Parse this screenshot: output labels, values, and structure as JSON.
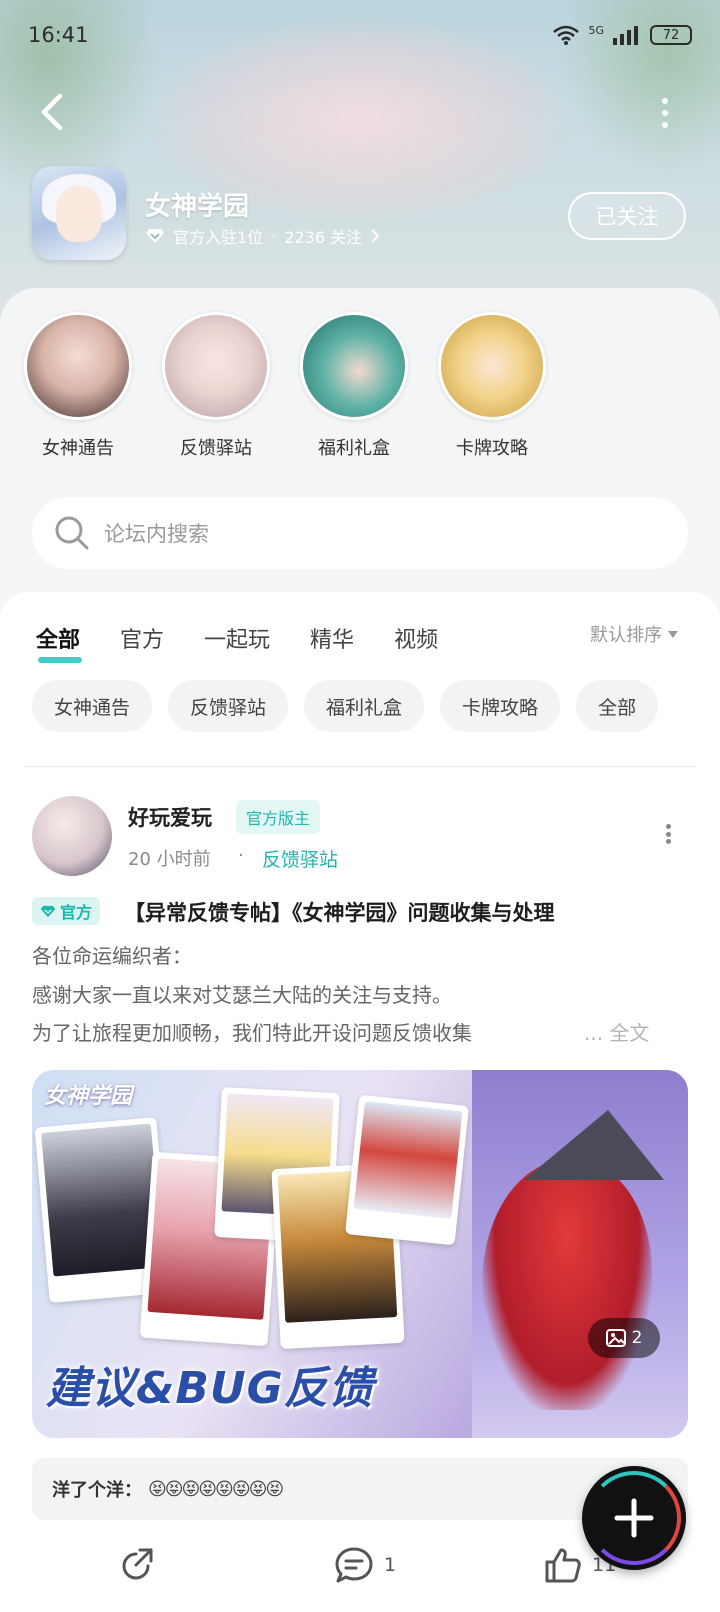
{
  "status_bar": {
    "time": "16:41",
    "network": "5G",
    "battery": "72"
  },
  "forum": {
    "name": "女神学园",
    "meta_official": "官方入驻1位",
    "meta_sep": "·",
    "meta_follow": "2236 关注",
    "follow_button": "已关注"
  },
  "shortcuts": [
    {
      "label": "女神通告"
    },
    {
      "label": "反馈驿站"
    },
    {
      "label": "福利礼盒"
    },
    {
      "label": "卡牌攻略"
    }
  ],
  "search": {
    "placeholder": "论坛内搜索"
  },
  "tabs": [
    "全部",
    "官方",
    "一起玩",
    "精华",
    "视频"
  ],
  "sort": {
    "label": "默认排序"
  },
  "chips": [
    "女神通告",
    "反馈驿站",
    "福利礼盒",
    "卡牌攻略",
    "全部"
  ],
  "post": {
    "author": "好玩爱玩",
    "author_badge": "官方版主",
    "time": "20 小时前",
    "dot": "·",
    "board": "反馈驿站",
    "official_tag": "官方",
    "title": "【异常反馈专帖】《女神学园》问题收集与处理",
    "body": [
      "各位命运编织者：",
      "感谢大家一直以来对艾瑟兰大陆的关注与支持。",
      "为了让旅程更加顺畅，我们特此开设问题反馈收集"
    ],
    "more_text": "... 全文",
    "banner": {
      "logo_text": "女神学园",
      "headline": "建议&BUG反馈",
      "image_count": "2"
    },
    "comment": {
      "user": "洋了个洋：",
      "emojis": "😝😝😝😝😝😝😝😝"
    },
    "actions": {
      "comments": "1",
      "likes": "11"
    }
  },
  "colors": {
    "accent": "#1fb6ae",
    "tab_underline": "#2fc8c3"
  }
}
